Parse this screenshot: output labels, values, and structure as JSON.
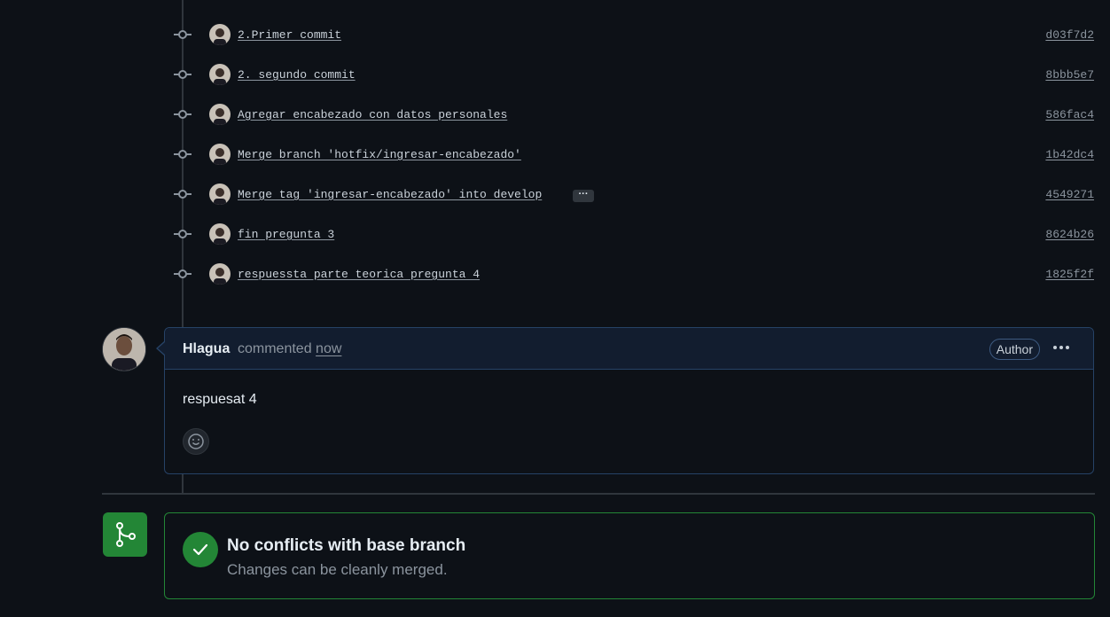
{
  "commits": [
    {
      "message": "2.Primer commit",
      "sha": "d03f7d2"
    },
    {
      "message": "2. segundo commit",
      "sha": "8bbb5e7"
    },
    {
      "message": "Agregar encabezado con datos personales",
      "sha": "586fac4"
    },
    {
      "message": "Merge branch 'hotfix/ingresar-encabezado'",
      "sha": "1b42dc4"
    },
    {
      "message": "Merge tag 'ingresar-encabezado' into develop",
      "sha": "4549271",
      "has_more": true
    },
    {
      "message": "fin pregunta 3",
      "sha": "8624b26"
    },
    {
      "message": "respuessta parte teorica pregunta 4",
      "sha": "1825f2f"
    }
  ],
  "comment": {
    "author": "Hlagua",
    "action": "commented",
    "time": "now",
    "badge": "Author",
    "body": "respuesat 4",
    "more_icon": "kebab-horizontal-icon",
    "reaction_icon": "smiley-icon"
  },
  "merge_status": {
    "title": "No conflicts with base branch",
    "subtitle": "Changes can be cleanly merged.",
    "icon": "git-merge-icon",
    "status_icon": "check-icon",
    "color": "#238636"
  },
  "colors": {
    "background": "#0d1117",
    "comment_header": "#121d2f",
    "border": "#30363d",
    "success": "#238636"
  }
}
